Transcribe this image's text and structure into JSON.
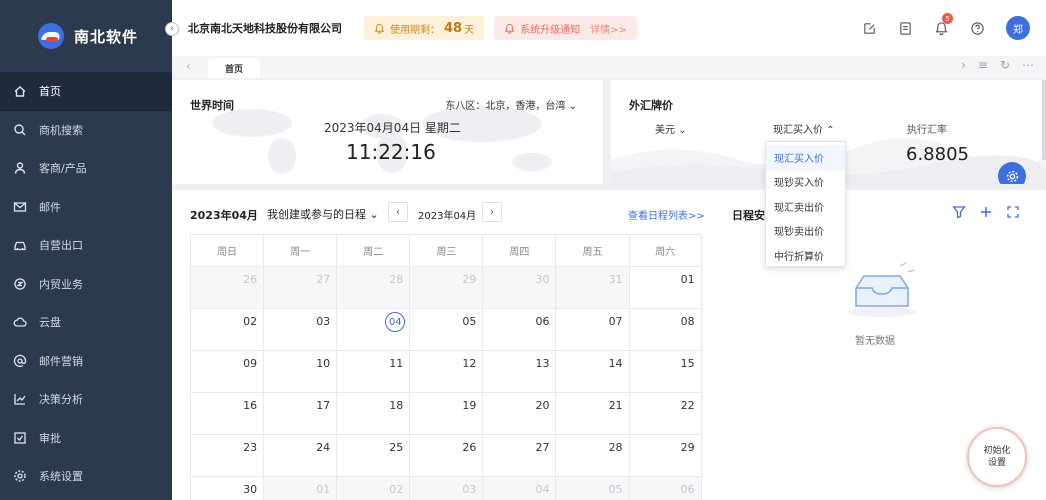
{
  "app": {
    "name": "南北软件"
  },
  "sidebar": {
    "items": [
      {
        "label": "首页",
        "icon": "home-icon",
        "active": true
      },
      {
        "label": "商机搜索",
        "icon": "search-icon"
      },
      {
        "label": "客商/产品",
        "icon": "user-icon"
      },
      {
        "label": "邮件",
        "icon": "mail-icon"
      },
      {
        "label": "自营出口",
        "icon": "car-icon"
      },
      {
        "label": "内贸业务",
        "icon": "trade-icon"
      },
      {
        "label": "云盘",
        "icon": "cloud-icon"
      },
      {
        "label": "邮件营销",
        "icon": "at-icon"
      },
      {
        "label": "决策分析",
        "icon": "chart-icon"
      },
      {
        "label": "审批",
        "icon": "approve-icon"
      },
      {
        "label": "系统设置",
        "icon": "settings-icon"
      }
    ]
  },
  "header": {
    "company": "北京南北天地科技股份有限公司",
    "trial_label": "使用期剩：",
    "trial_days": "48",
    "trial_unit": "天",
    "notice_label": "系统升级通知",
    "notice_detail": "详情>>",
    "notification_count": "5",
    "avatar_text": "郑"
  },
  "tabs": {
    "home": "首页"
  },
  "world_time": {
    "title": "世界时间",
    "timezone": "东八区：北京，香港，台湾",
    "date": "2023年04月04日 星期二",
    "time": "11:22:16"
  },
  "fx": {
    "title": "外汇牌价",
    "currency": "美元",
    "price_type": "现汇买入价",
    "exec_label": "执行汇率",
    "exec_value": "6.8805",
    "options": [
      "现汇买入价",
      "现钞买入价",
      "现汇卖出价",
      "现钞卖出价",
      "中行折算价"
    ]
  },
  "calendar": {
    "month_title": "2023年04月",
    "filter": "我创建或参与的日程",
    "nav_month": "2023年04月",
    "list_link": "查看日程列表>>",
    "weekdays": [
      "周日",
      "周一",
      "周二",
      "周三",
      "周四",
      "周五",
      "周六"
    ],
    "weeks": [
      [
        {
          "d": "26",
          "m": true
        },
        {
          "d": "27",
          "m": true
        },
        {
          "d": "28",
          "m": true
        },
        {
          "d": "29",
          "m": true
        },
        {
          "d": "30",
          "m": true
        },
        {
          "d": "31",
          "m": true
        },
        {
          "d": "01"
        }
      ],
      [
        {
          "d": "02"
        },
        {
          "d": "03"
        },
        {
          "d": "04",
          "today": true
        },
        {
          "d": "05"
        },
        {
          "d": "06"
        },
        {
          "d": "07"
        },
        {
          "d": "08"
        }
      ],
      [
        {
          "d": "09"
        },
        {
          "d": "10"
        },
        {
          "d": "11"
        },
        {
          "d": "12"
        },
        {
          "d": "13"
        },
        {
          "d": "14"
        },
        {
          "d": "15"
        }
      ],
      [
        {
          "d": "16"
        },
        {
          "d": "17"
        },
        {
          "d": "18"
        },
        {
          "d": "19"
        },
        {
          "d": "20"
        },
        {
          "d": "21"
        },
        {
          "d": "22"
        }
      ],
      [
        {
          "d": "23"
        },
        {
          "d": "24"
        },
        {
          "d": "25"
        },
        {
          "d": "26"
        },
        {
          "d": "27"
        },
        {
          "d": "28"
        },
        {
          "d": "29"
        }
      ],
      [
        {
          "d": "30"
        },
        {
          "d": "01",
          "m": true
        },
        {
          "d": "02",
          "m": true
        },
        {
          "d": "03",
          "m": true
        },
        {
          "d": "04",
          "m": true
        },
        {
          "d": "05",
          "m": true
        },
        {
          "d": "06",
          "m": true
        }
      ]
    ]
  },
  "schedule": {
    "title": "日程安",
    "empty_text": "暂无数据",
    "init_line1": "初始化",
    "init_line2": "设置"
  },
  "colors": {
    "sidebar_bg": "#2b3a4f",
    "accent": "#3d6fe0",
    "warning": "#d48a1e",
    "danger": "#e7695e"
  }
}
